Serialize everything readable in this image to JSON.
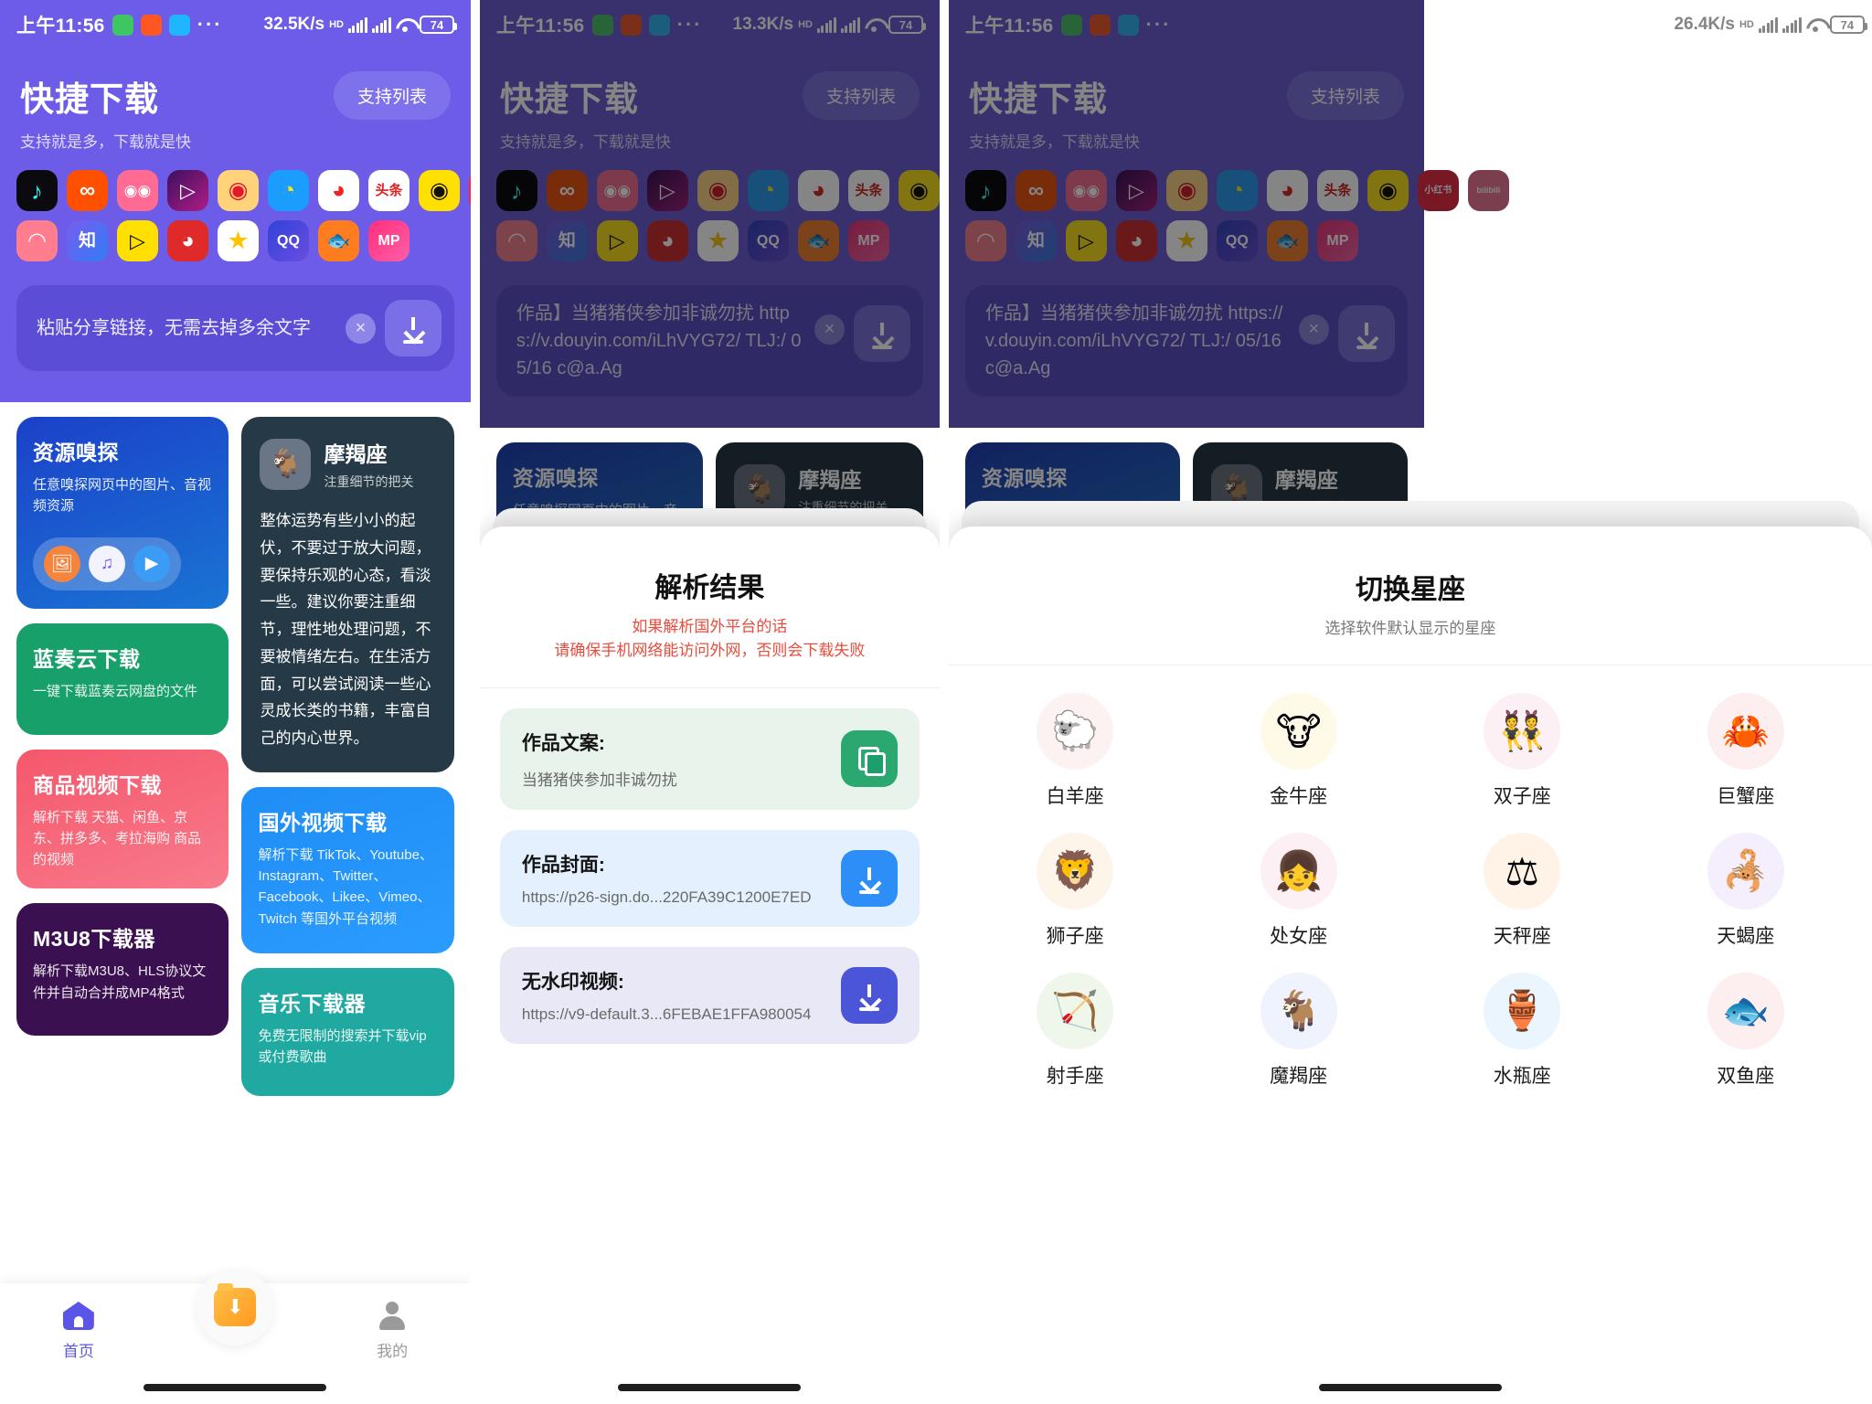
{
  "status_bars": [
    {
      "time": "上午11:56",
      "apps": [
        "wechat-icon",
        "mi-icon",
        "browser-icon"
      ],
      "more": "···",
      "net_speed": "32.5K/s",
      "hd": "HD",
      "battery": "74"
    },
    {
      "time": "上午11:56",
      "apps": [
        "wechat-icon",
        "mi-icon",
        "browser-icon"
      ],
      "more": "···",
      "net_speed": "13.3K/s",
      "hd": "HD",
      "battery": "74"
    },
    {
      "time": "上午11:56",
      "apps": [
        "wechat-icon",
        "mi-icon",
        "browser-icon"
      ],
      "more": "···",
      "net_speed": "26.4K/s",
      "hd": "HD",
      "battery": "74"
    }
  ],
  "hero": {
    "title": "快捷下载",
    "subtitle": "支持就是多，下载就是快",
    "support_button": "支持列表",
    "bg_color": "#6c5ce7",
    "app_icons_row1": [
      {
        "name": "douyin-icon",
        "label": "♪",
        "bg": "#0b0b0f",
        "fg": "#25f4ee"
      },
      {
        "name": "kuaishou-icon",
        "label": "∞",
        "bg": "#ff5000",
        "fg": "#ffffff"
      },
      {
        "name": "xigua-icon",
        "label": "◉◉",
        "bg": "#ff6b93",
        "fg": "#ffffff"
      },
      {
        "name": "pipixia-icon",
        "label": "▷",
        "bg": "#1d0b2e",
        "fg": "#ffffff"
      },
      {
        "name": "weibo-icon",
        "label": "◉",
        "bg": "#ffd37a",
        "fg": "#e6162d"
      },
      {
        "name": "zuiyou-icon",
        "label": "◔",
        "bg": "#1b9cff",
        "fg": "#ffe400"
      },
      {
        "name": "xiaoshipin-icon",
        "label": "◕",
        "bg": "#ffffff",
        "fg": "#f02222"
      },
      {
        "name": "toutiao-icon",
        "label": "头条",
        "bg": "#ffffff",
        "fg": "#e02020"
      },
      {
        "name": "qiezi-icon",
        "label": "◉",
        "bg": "#ffe000",
        "fg": "#111111"
      },
      {
        "name": "xiaohongshu-icon",
        "label": "小红书",
        "bg": "#ff2741",
        "fg": "#ffffff"
      },
      {
        "name": "bilibili-icon",
        "label": "bilibili",
        "bg": "#fb7299",
        "fg": "#ffffff"
      }
    ],
    "app_icons_row2": [
      {
        "name": "huoshan-icon",
        "label": "◠",
        "bg": "#ff7d8f",
        "fg": "#ffffff"
      },
      {
        "name": "zhihu-icon",
        "label": "知",
        "bg": "#4b7bff",
        "fg": "#ffffff"
      },
      {
        "name": "lishipin-icon",
        "label": "▷",
        "bg": "#ffe000",
        "fg": "#111111"
      },
      {
        "name": "momo-icon",
        "label": "◕",
        "bg": "#e02a2a",
        "fg": "#ffffff"
      },
      {
        "name": "quanmin-icon",
        "label": "★",
        "bg": "#ffffff",
        "fg": "#ffc400"
      },
      {
        "name": "qq-icon",
        "label": "QQ",
        "bg": "#3b5cf0",
        "fg": "#ffffff"
      },
      {
        "name": "douyu-icon",
        "label": "🐟",
        "bg": "#ff7c1f",
        "fg": "#ffffff"
      },
      {
        "name": "mp-icon",
        "label": "MP",
        "bg": "#ff2f7b",
        "fg": "#ffffff"
      }
    ],
    "input_placeholder": "粘贴分享链接，无需去掉多余文字",
    "input_value_filled": "作品】当猪猪侠参加非诚勿扰 https://v.douyin.com/iLhVYG72/ TLJ:/ 05/16 c@a.Ag",
    "clear_icon": "×",
    "download_icon": "download-arrow"
  },
  "cards": {
    "sniff": {
      "title": "资源嗅探",
      "desc": "任意嗅探网页中的图片、音视频资源",
      "bg": "#1558d6",
      "icons": [
        {
          "name": "image-icon",
          "glyph": "🖼",
          "bg": "#f5843c"
        },
        {
          "name": "music-icon",
          "glyph": "♫",
          "bg": "#f3f3ff"
        },
        {
          "name": "video-icon",
          "glyph": "▶",
          "bg": "#3b9cf5"
        }
      ]
    },
    "lanzou": {
      "title": "蓝奏云下载",
      "desc": "一键下载蓝奏云网盘的文件",
      "bg": "#17a06a"
    },
    "goods": {
      "title": "商品视频下载",
      "desc": "解析下载 天猫、闲鱼、京东、拼多多、考拉海购 商品的视频",
      "bg": "#f5576c"
    },
    "m3u8": {
      "title": "M3U8下载器",
      "desc": "解析下载M3U8、HLS协议文件并自动合并成MP4格式",
      "bg": "#3b1050"
    },
    "horoscope": {
      "sign": "摩羯座",
      "tag": "注重细节的把关",
      "avatar": "capricorn-icon",
      "body": "整体运势有些小小的起伏，不要过于放大问题，要保持乐观的心态，看淡一些。建议你要注重细节，理性地处理问题，不要被情绪左右。在生活方面，可以尝试阅读一些心灵成长类的书籍，丰富自己的内心世界。",
      "bg": "#253947"
    },
    "overseas": {
      "title": "国外视频下载",
      "desc": "解析下载 TikTok、Youtube、Instagram、Twitter、Facebook、Likee、Vimeo、Twitch 等国外平台视频",
      "bg": "#1f8df5"
    },
    "music": {
      "title": "音乐下载器",
      "desc": "免费无限制的搜索并下载vip或付费歌曲",
      "bg": "#1fa9a0"
    }
  },
  "tabbar": {
    "home_label": "首页",
    "home_icon": "home-icon",
    "fab_icon": "folder-download-icon",
    "mine_label": "我的",
    "mine_icon": "person-icon"
  },
  "parse_sheet": {
    "title": "解析结果",
    "warning_line1": "如果解析国外平台的话",
    "warning_line2": "请确保手机网络能访问外网，否则会下载失败",
    "warning_color": "#e74c3c",
    "items": [
      {
        "label": "作品文案:",
        "value": "当猪猪侠参加非诚勿扰",
        "bg": "#e8f3ec",
        "btn_bg": "#2aa870",
        "btn_icon": "copy-icon"
      },
      {
        "label": "作品封面:",
        "value": "https://p26-sign.do...220FA39C1200E7ED",
        "bg": "#e4f0fd",
        "btn_bg": "#2e8ef7",
        "btn_icon": "download-icon"
      },
      {
        "label": "无水印视频:",
        "value": "https://v9-default.3...6FEBAE1FFA980054",
        "bg": "#e9e8f7",
        "btn_bg": "#4a55d8",
        "btn_icon": "download-icon"
      }
    ]
  },
  "zodiac_sheet": {
    "title": "切换星座",
    "subtitle": "选择软件默认显示的星座",
    "signs": [
      {
        "name": "白羊座",
        "icon": "aries-icon",
        "glyph": "🐑",
        "bg": "#fdf2f2"
      },
      {
        "name": "金牛座",
        "icon": "taurus-icon",
        "glyph": "🐮",
        "bg": "#fff9e8"
      },
      {
        "name": "双子座",
        "icon": "gemini-icon",
        "glyph": "👯",
        "bg": "#fdf0f5"
      },
      {
        "name": "巨蟹座",
        "icon": "cancer-icon",
        "glyph": "🦀",
        "bg": "#fdeff0"
      },
      {
        "name": "狮子座",
        "icon": "leo-icon",
        "glyph": "🦁",
        "bg": "#fdf4ea"
      },
      {
        "name": "处女座",
        "icon": "virgo-icon",
        "glyph": "👧",
        "bg": "#fdf0f4"
      },
      {
        "name": "天秤座",
        "icon": "libra-icon",
        "glyph": "⚖",
        "bg": "#fff3e8"
      },
      {
        "name": "天蝎座",
        "icon": "scorpio-icon",
        "glyph": "🦂",
        "bg": "#f4eefd"
      },
      {
        "name": "射手座",
        "icon": "sagittarius-icon",
        "glyph": "🏹",
        "bg": "#eff7ea"
      },
      {
        "name": "魔羯座",
        "icon": "capricorn-icon",
        "glyph": "🐐",
        "bg": "#eef3fd"
      },
      {
        "name": "水瓶座",
        "icon": "aquarius-icon",
        "glyph": "🏺",
        "bg": "#eaf5fd"
      },
      {
        "name": "双鱼座",
        "icon": "pisces-icon",
        "glyph": "🐟",
        "bg": "#fdeff0"
      }
    ]
  }
}
